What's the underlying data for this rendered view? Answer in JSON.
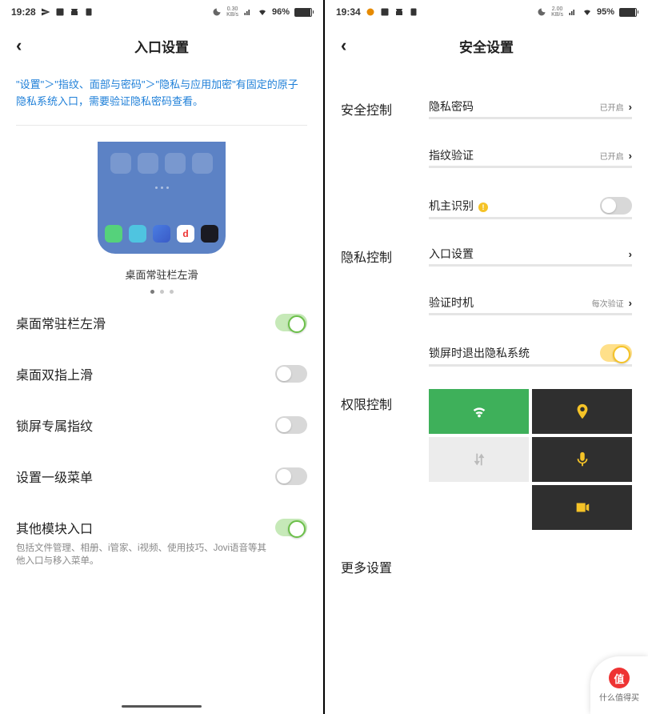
{
  "left": {
    "status": {
      "time": "19:28",
      "kbs": "0.30\nKB/s",
      "battery": "96%"
    },
    "title": "入口设置",
    "blurb": "\"设置\"＞\"指纹、面部与密码\"＞\"隐私与应用加密\"有固定的原子隐私系统入口，需要验证隐私密码查看。",
    "illustration_caption": "桌面常驻栏左滑",
    "rows": [
      {
        "label": "桌面常驻栏左滑",
        "on": true
      },
      {
        "label": "桌面双指上滑",
        "on": false
      },
      {
        "label": "锁屏专属指纹",
        "on": false
      },
      {
        "label": "设置一级菜单",
        "on": false
      },
      {
        "label": "其他模块入口",
        "sub": "包括文件管理、相册、i管家、i视频、使用技巧、Jovi语音等其他入口与移入菜单。",
        "on": true
      }
    ]
  },
  "right": {
    "status": {
      "time": "19:34",
      "kbs": "2.00\nKB/s",
      "battery": "95%"
    },
    "title": "安全设置",
    "sections": [
      {
        "header": "安全控制",
        "items": [
          {
            "label": "隐私密码",
            "value": "已开启",
            "chevron": true
          },
          {
            "label": "指纹验证",
            "value": "已开启",
            "chevron": true
          },
          {
            "label": "机主识别",
            "warn": true,
            "toggle": true,
            "on": false
          }
        ]
      },
      {
        "header": "隐私控制",
        "items": [
          {
            "label": "入口设置",
            "chevron": true
          },
          {
            "label": "验证时机",
            "value": "每次验证",
            "chevron": true
          },
          {
            "label": "锁屏时退出隐私系统",
            "toggle": true,
            "on": true,
            "yel": true
          }
        ]
      },
      {
        "header": "权限控制",
        "perm": true,
        "cells": [
          {
            "color": "g",
            "icon": "wifi"
          },
          {
            "color": "d",
            "icon": "location"
          },
          {
            "color": "l",
            "icon": "data"
          },
          {
            "color": "d",
            "icon": "mic"
          },
          {
            "color": "empty"
          },
          {
            "color": "d",
            "icon": "camera"
          }
        ]
      },
      {
        "header": "更多设置"
      }
    ]
  },
  "watermark": {
    "char": "值",
    "text": "什么值得买"
  }
}
